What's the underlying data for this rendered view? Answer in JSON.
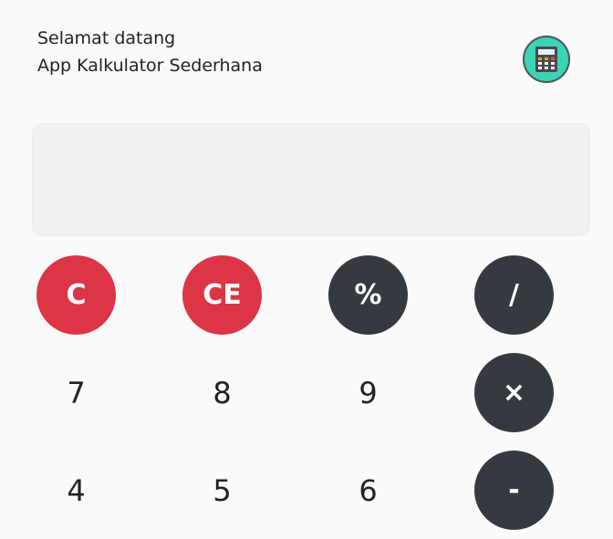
{
  "header": {
    "greeting": "Selamat datang",
    "app_name": "App Kalkulator Sederhana"
  },
  "icon": {
    "name": "calculator-icon"
  },
  "display": {
    "value": ""
  },
  "keys": {
    "clear": "C",
    "clear_entry": "CE",
    "percent": "%",
    "divide": "/",
    "seven": "7",
    "eight": "8",
    "nine": "9",
    "multiply": "×",
    "four": "4",
    "five": "5",
    "six": "6",
    "subtract": "-"
  },
  "colors": {
    "danger": "#dc3545",
    "dark": "#343a40",
    "icon_bg": "#3ad4b6",
    "display_bg": "#f1f1f1"
  }
}
